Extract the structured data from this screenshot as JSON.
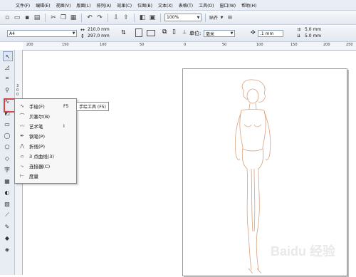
{
  "menubar": {
    "items": [
      "文件(F)",
      "编辑(E)",
      "视图(V)",
      "版面(L)",
      "排列(A)",
      "效果(C)",
      "位图(B)",
      "文本(X)",
      "表格(T)",
      "工具(O)",
      "窗口(W)",
      "帮助(H)"
    ]
  },
  "toolbar1": {
    "zoom": "100%",
    "snap": "贴齐"
  },
  "toolbar2": {
    "paper_size": "A4",
    "width": "210.0 mm",
    "height": "297.0 mm",
    "unit_label": "单位:",
    "unit_value": "毫米",
    "nudge": ".1 mm",
    "dup_x": "5.0 mm",
    "dup_y": "5.0 mm"
  },
  "ruler": {
    "top": [
      "200",
      "150",
      "100",
      "50",
      "0",
      "50",
      "100",
      "150",
      "200",
      "250"
    ],
    "left": [
      "3",
      "0",
      "0"
    ]
  },
  "flyout": {
    "items": [
      {
        "label": "手绘(F)",
        "key": "F5"
      },
      {
        "label": "贝塞尔(B)",
        "key": ""
      },
      {
        "label": "艺术笔",
        "key": "I"
      },
      {
        "label": "钢笔(P)",
        "key": ""
      },
      {
        "label": "折线(P)",
        "key": ""
      },
      {
        "label": "3 点曲线(3)",
        "key": ""
      },
      {
        "label": "连接器(C)",
        "key": ""
      },
      {
        "label": "度量",
        "key": ""
      }
    ]
  },
  "tooltip": "手绘工具 (F5)",
  "watermark": "Baidu 经验",
  "colors": {
    "highlight": "#d64545",
    "figure_stroke": "#d9a07a"
  }
}
